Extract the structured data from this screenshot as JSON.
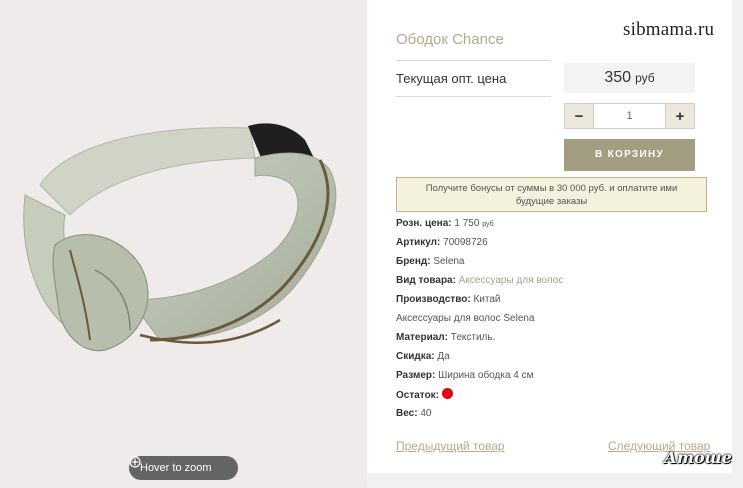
{
  "watermark": "sibmama.ru",
  "product": {
    "title": "Ободок Chance",
    "price_label": "Текущая опт. цена",
    "price_value": "350",
    "price_currency": "руб"
  },
  "cart": {
    "minus": "−",
    "quantity": "1",
    "plus": "+",
    "add_label": "В КОРЗИНУ"
  },
  "bonus_text": "Получите бонусы от суммы в 30 000 руб. и оплатите ими будущие заказы",
  "specs": {
    "retail_label": "Розн. цена:",
    "retail_value": "1 750",
    "retail_currency": "руб",
    "article_label": "Артикул:",
    "article_value": "70098726",
    "brand_label": "Бренд:",
    "brand_value": "Selena",
    "type_label": "Вид товара:",
    "type_value": "Аксессуары для волос",
    "origin_label": "Производство:",
    "origin_value": "Китай",
    "category_line": "Аксессуары для волос Selena",
    "material_label": "Материал:",
    "material_value": "Текстиль.",
    "discount_label": "Скидка:",
    "discount_value": "Да",
    "size_label": "Размер:",
    "size_value": "Ширина ободка 4 см",
    "stock_label": "Остаток:",
    "weight_label": "Вес:",
    "weight_value": "40"
  },
  "nav": {
    "prev": "Предыдущий товар",
    "next": "Следующий товар"
  },
  "zoom_hint": "Hover to zoom",
  "signature": "Атоше",
  "colors": {
    "accent": "#b7a98a",
    "cart_button": "#a39d82",
    "stock_dot": "#e8000d"
  }
}
